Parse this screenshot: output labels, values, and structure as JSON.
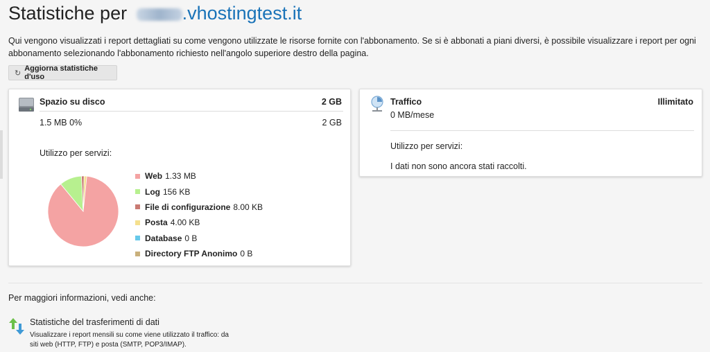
{
  "header": {
    "title_prefix": "Statistiche per",
    "domain": ".vhostingtest.it"
  },
  "intro": {
    "text": "Qui vengono visualizzati i report dettagliati su come vengono utilizzate le risorse fornite con l'abbonamento. Se si è abbonati a piani diversi, è possibile visualizzare i report per ogni abbonamento selezionando l'abbonamento richiesto nell'angolo superiore destro della pagina."
  },
  "toolbar": {
    "refresh_icon": "refresh-icon",
    "refresh_label": "Aggiorna statistiche d'uso"
  },
  "disk": {
    "icon": "hard-drive-icon",
    "title": "Spazio su disco",
    "limit": "2 GB",
    "usage_text": "1.5 MB 0%",
    "usage_total": "2 GB",
    "services_label": "Utilizzo per servizi:",
    "legend": [
      {
        "name": "Web",
        "value": "1.33 MB",
        "color": "#f4a3a3"
      },
      {
        "name": "Log",
        "value": "156 KB",
        "color": "#b7f08f"
      },
      {
        "name": "File di configurazione",
        "value": "8.00 KB",
        "color": "#c97a73"
      },
      {
        "name": "Posta",
        "value": "4.00 KB",
        "color": "#f5e08e"
      },
      {
        "name": "Database",
        "value": "0 B",
        "color": "#67c9ea"
      },
      {
        "name": "Directory FTP Anonimo",
        "value": "0 B",
        "color": "#c9b07c"
      }
    ],
    "pie_values_kb": [
      1362,
      156,
      8,
      4,
      0,
      0
    ]
  },
  "traffic": {
    "icon": "traffic-gauge-icon",
    "title": "Traffico",
    "limit": "Illimitato",
    "usage_text": "0 MB/mese",
    "services_label": "Utilizzo per servizi:",
    "empty_text": "I dati non sono ancora stati raccolti."
  },
  "footer": {
    "more_info": "Per maggiori informazioni, vedi anche:",
    "related": {
      "icon": "transfer-arrows-icon",
      "title": "Statistiche del trasferimenti di dati",
      "description": "Visualizzare i report mensili su come viene utilizzato il traffico: da siti web (HTTP, FTP) e posta (SMTP, POP3/IMAP)."
    }
  }
}
